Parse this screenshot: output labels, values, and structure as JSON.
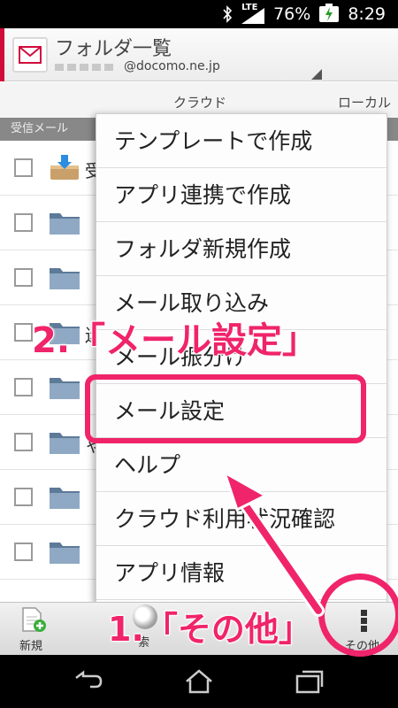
{
  "status_bar": {
    "network_label": "LTE",
    "battery_percent": "76%",
    "time": "8:29"
  },
  "header": {
    "title": "フォルダ一覧",
    "account_suffix": "@docomo.ne.jp"
  },
  "tabs": {
    "cloud": "クラウド",
    "local": "ローカル"
  },
  "list": {
    "section_header": "受信メール",
    "rows": [
      {
        "label": "受"
      },
      {
        "label": ""
      },
      {
        "label": ""
      },
      {
        "label": "迷"
      },
      {
        "label": ""
      },
      {
        "label": "ゃ"
      },
      {
        "label": ""
      },
      {
        "label": ""
      }
    ]
  },
  "menu": {
    "items": [
      "テンプレートで作成",
      "アプリ連携で作成",
      "フォルダ新規作成",
      "メール取り込み",
      "メール振分け",
      "メール設定",
      "ヘルプ",
      "クラウド利用状況確認",
      "アプリ情報"
    ]
  },
  "action_bar": {
    "new_label": "新規",
    "mid_label": "索",
    "other_label": "その他"
  },
  "annotations": {
    "step2": "2.「メール設定」",
    "step1": "1.「その他」"
  },
  "colors": {
    "accent_red": "#d10b3c",
    "annotation_pink": "#f0246a"
  }
}
